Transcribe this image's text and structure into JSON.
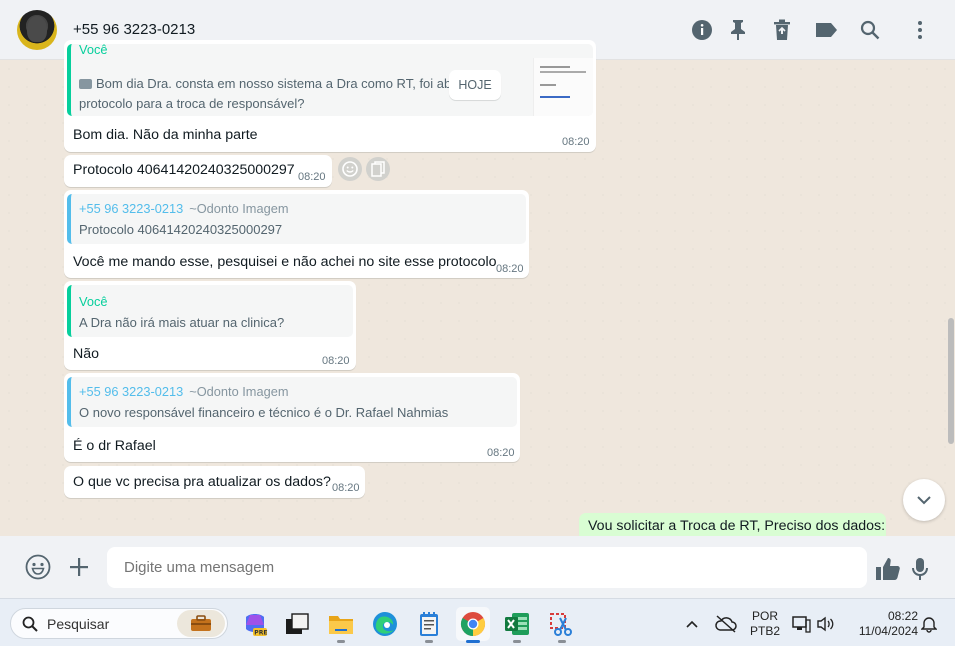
{
  "header": {
    "contact_name": "+55 96 3223-0213",
    "icons": [
      "info-icon",
      "pin-icon",
      "delete-icon",
      "label-icon",
      "search-icon",
      "more-icon"
    ]
  },
  "chat": {
    "date_chip": "HOJE",
    "messages": [
      {
        "quote_author": "Você",
        "quote_text": "Bom dia Dra. consta em nosso sistema a Dra como RT, foi aberto um protocolo para a troca de responsável?",
        "text": "Bom dia. Não da minha parte",
        "time": "08:20"
      },
      {
        "text": "Protocolo 40641420240325000297",
        "time": "08:20"
      },
      {
        "quote_author": "+55 96 3223-0213",
        "quote_push": "~Odonto Imagem",
        "quote_text": "Protocolo 40641420240325000297",
        "text": "Você me mando esse, pesquisei e não achei no site esse protocolo",
        "time": "08:20"
      },
      {
        "quote_author": "Você",
        "quote_text": "A Dra não irá mais atuar na clinica?",
        "text": "Não",
        "time": "08:20"
      },
      {
        "quote_author": "+55 96 3223-0213",
        "quote_push": "~Odonto Imagem",
        "quote_text": "O novo responsável financeiro e técnico é o Dr. Rafael Nahmias",
        "text": "É o dr Rafael",
        "time": "08:20"
      },
      {
        "text": "O que vc precisa pra atualizar os dados?",
        "time": "08:20"
      },
      {
        "text": "Vou solicitar a Troca de RT, Preciso dos dados:",
        "outgoing": true
      }
    ]
  },
  "compose": {
    "placeholder": "Digite uma mensagem"
  },
  "taskbar": {
    "search_label": "Pesquisar",
    "language": "POR",
    "keyboard": "PTB2",
    "time": "08:22",
    "date": "11/04/2024"
  },
  "colors": {
    "accent_green": "#06cf9c",
    "quote_blue": "#53bdeb",
    "outgoing_bubble": "#d9fdd3",
    "chat_bg": "#efe7dd"
  }
}
